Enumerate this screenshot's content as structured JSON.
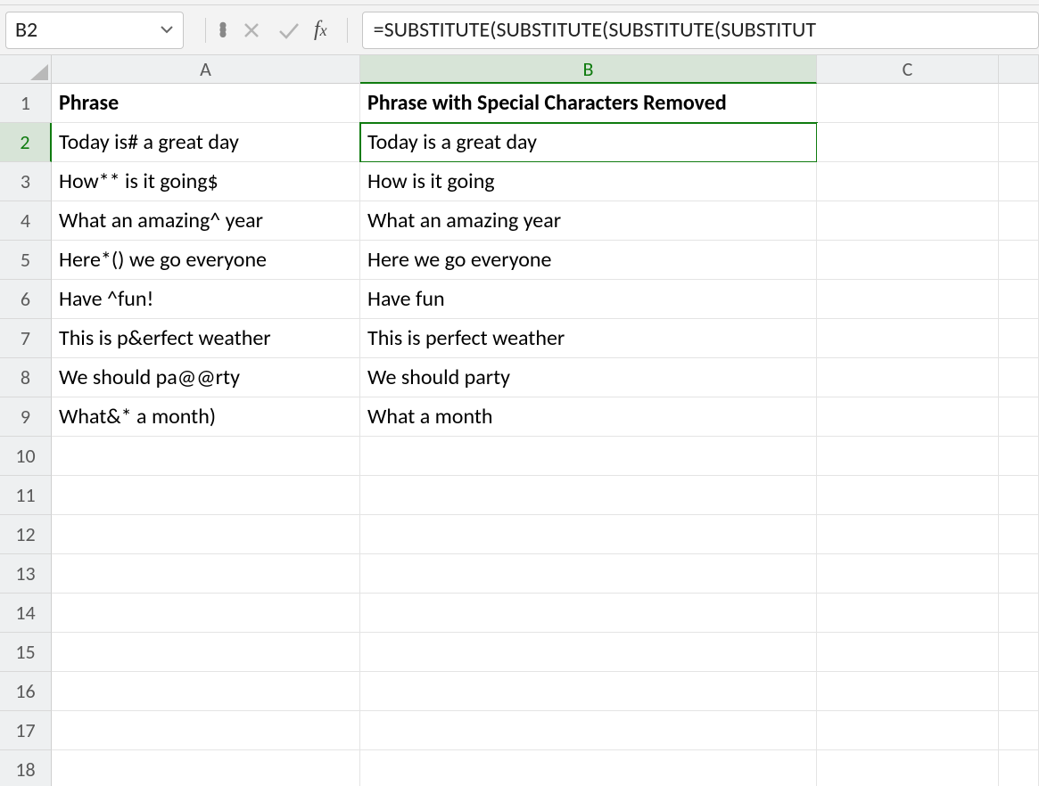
{
  "formula_bar": {
    "cell_ref": "B2",
    "formula": "=SUBSTITUTE(SUBSTITUTE(SUBSTITUTE(SUBSTITUT"
  },
  "columns": [
    "A",
    "B",
    "C"
  ],
  "headers": {
    "A": "Phrase",
    "B": "Phrase with Special Characters Removed"
  },
  "rows": [
    {
      "n": 2,
      "A": "Today is# a great day",
      "B": "Today is a great day"
    },
    {
      "n": 3,
      "A": "How** is it going$",
      "B": "How is it going"
    },
    {
      "n": 4,
      "A": "What an amazing^ year",
      "B": "What an amazing year"
    },
    {
      "n": 5,
      "A": "Here*() we go everyone",
      "B": "Here we go everyone"
    },
    {
      "n": 6,
      "A": "Have ^fun!",
      "B": "Have fun"
    },
    {
      "n": 7,
      "A": "This is p&erfect weather",
      "B": "This is perfect weather"
    },
    {
      "n": 8,
      "A": "We should pa@@rty",
      "B": "We should party"
    },
    {
      "n": 9,
      "A": "What&* a month)",
      "B": "What a month"
    }
  ],
  "blank_rows": [
    10,
    11,
    12,
    13,
    14,
    15,
    16,
    17,
    18
  ],
  "active_cell": "B2"
}
